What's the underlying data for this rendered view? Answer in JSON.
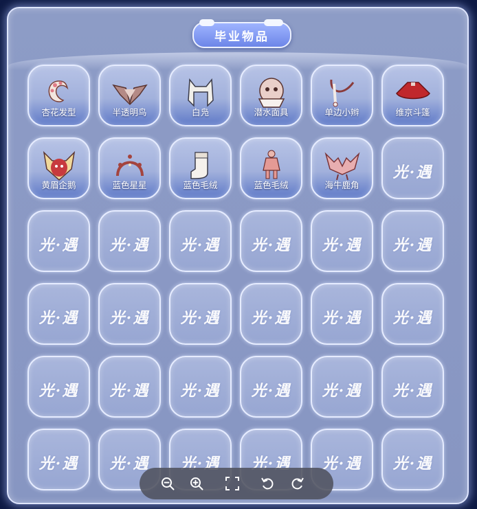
{
  "title": "毕业物品",
  "watermark": "光·遇",
  "items": [
    {
      "label": "杏花发型",
      "icon": "hair-icon",
      "filled": true
    },
    {
      "label": "半透明鸟",
      "icon": "bird-mask-icon",
      "filled": true
    },
    {
      "label": "白凫",
      "icon": "white-hood-icon",
      "filled": true
    },
    {
      "label": "潜水面具",
      "icon": "diving-mask-icon",
      "filled": true
    },
    {
      "label": "单边小辫",
      "icon": "braid-icon",
      "filled": true
    },
    {
      "label": "维京斗篷",
      "icon": "cape-icon",
      "filled": true
    },
    {
      "label": "黄眉企鹅",
      "icon": "penguin-mask-icon",
      "filled": true
    },
    {
      "label": "蓝色星星",
      "icon": "star-headpiece-icon",
      "filled": true
    },
    {
      "label": "蓝色毛绒",
      "icon": "boot-icon",
      "filled": true
    },
    {
      "label": "蓝色毛绒",
      "icon": "outfit-icon",
      "filled": true
    },
    {
      "label": "海牛鹿角",
      "icon": "antler-icon",
      "filled": true
    }
  ],
  "empty_slots": 25,
  "toolbar": [
    "zoom-out-icon",
    "zoom-in-icon",
    "fullscreen-icon",
    "rotate-left-icon",
    "rotate-right-icon"
  ]
}
